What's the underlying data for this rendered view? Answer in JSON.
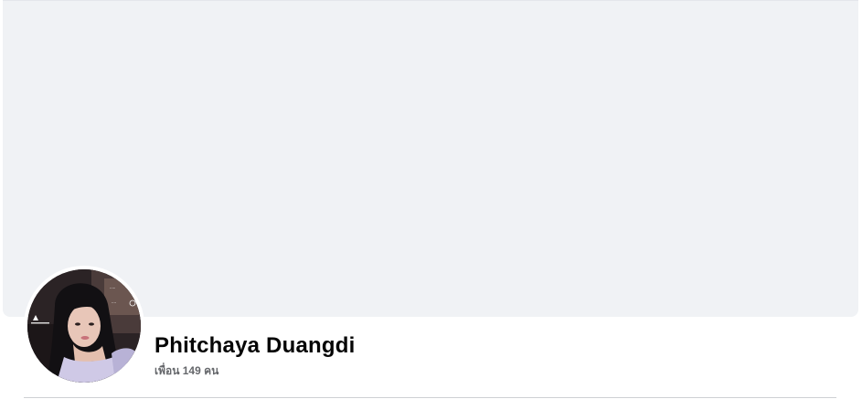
{
  "profile": {
    "name": "Phitchaya Duangdi",
    "friends_count": "เพื่อน 149 คน"
  },
  "avatar": {
    "icon": "profile-photo"
  },
  "colors": {
    "cover_background": "#f0f2f5",
    "name_text": "#050505",
    "secondary_text": "#65676b",
    "divider": "#ced0d4"
  }
}
